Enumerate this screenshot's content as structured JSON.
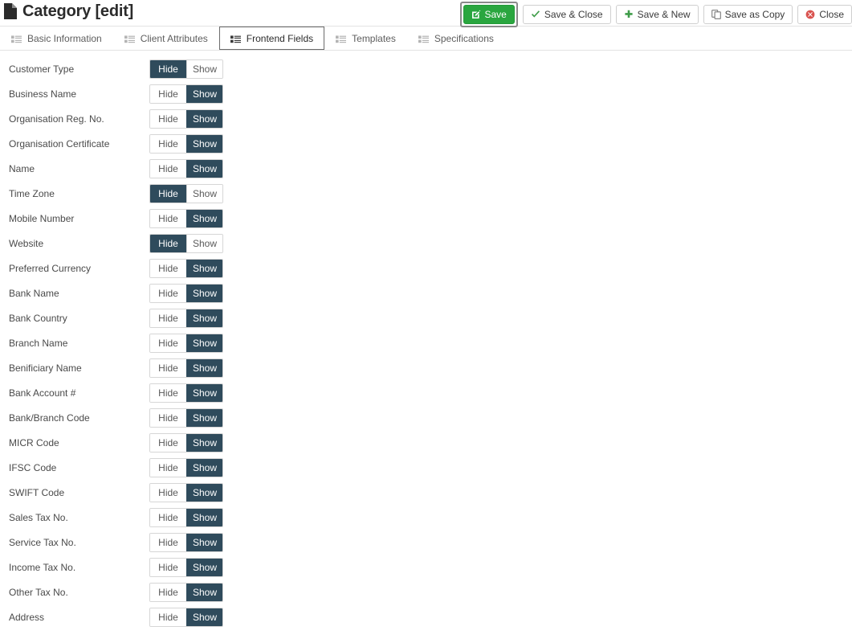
{
  "header": {
    "icon": "document-icon",
    "title": "Category [edit]"
  },
  "toolbar": {
    "buttons": [
      {
        "label": "Save",
        "icon": "edit-square-icon",
        "style": "primary",
        "focused": true,
        "icon_color": "#ffffff"
      },
      {
        "label": "Save & Close",
        "icon": "check-icon",
        "style": "default",
        "focused": false,
        "icon_color": "#3f9c49"
      },
      {
        "label": "Save & New",
        "icon": "plus-icon",
        "style": "default",
        "focused": false,
        "icon_color": "#3f9c49"
      },
      {
        "label": "Save as Copy",
        "icon": "copy-icon",
        "style": "default",
        "focused": false,
        "icon_color": "#7a7a7a"
      },
      {
        "label": "Close",
        "icon": "close-circle-icon",
        "style": "default",
        "focused": false,
        "icon_color": "#d9534f"
      }
    ]
  },
  "tabs": [
    {
      "label": "Basic Information",
      "icon": "list-icon",
      "active": false
    },
    {
      "label": "Client Attributes",
      "icon": "list-icon",
      "active": false
    },
    {
      "label": "Frontend Fields",
      "icon": "list-icon",
      "active": true
    },
    {
      "label": "Templates",
      "icon": "list-icon",
      "active": false
    },
    {
      "label": "Specifications",
      "icon": "list-icon",
      "active": false
    }
  ],
  "toggle": {
    "hide_label": "Hide",
    "show_label": "Show",
    "active_color": "#2f4b5c",
    "inactive_color": "#ffffff"
  },
  "fields": [
    {
      "label": "Customer Type",
      "value": "Hide"
    },
    {
      "label": "Business Name",
      "value": "Show"
    },
    {
      "label": "Organisation Reg. No.",
      "value": "Show"
    },
    {
      "label": "Organisation Certificate",
      "value": "Show"
    },
    {
      "label": "Name",
      "value": "Show"
    },
    {
      "label": "Time Zone",
      "value": "Hide"
    },
    {
      "label": "Mobile Number",
      "value": "Show"
    },
    {
      "label": "Website",
      "value": "Hide"
    },
    {
      "label": "Preferred Currency",
      "value": "Show"
    },
    {
      "label": "Bank Name",
      "value": "Show"
    },
    {
      "label": "Bank Country",
      "value": "Show"
    },
    {
      "label": "Branch Name",
      "value": "Show"
    },
    {
      "label": "Benificiary Name",
      "value": "Show"
    },
    {
      "label": "Bank Account #",
      "value": "Show"
    },
    {
      "label": "Bank/Branch Code",
      "value": "Show"
    },
    {
      "label": "MICR Code",
      "value": "Show"
    },
    {
      "label": "IFSC Code",
      "value": "Show"
    },
    {
      "label": "SWIFT Code",
      "value": "Show"
    },
    {
      "label": "Sales Tax No.",
      "value": "Show"
    },
    {
      "label": "Service Tax No.",
      "value": "Show"
    },
    {
      "label": "Income Tax No.",
      "value": "Show"
    },
    {
      "label": "Other Tax No.",
      "value": "Show"
    },
    {
      "label": "Address",
      "value": "Show"
    }
  ]
}
